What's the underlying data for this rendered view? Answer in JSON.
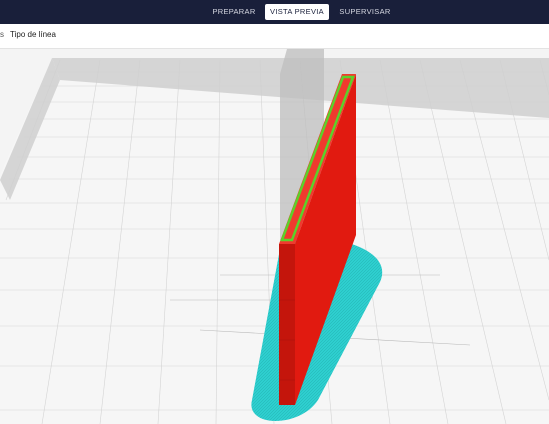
{
  "header": {
    "tabs": [
      {
        "label": "PREPARAR",
        "active": false
      },
      {
        "label": "VISTA PREVIA",
        "active": true
      },
      {
        "label": "SUPERVISAR",
        "active": false
      }
    ]
  },
  "toolbar": {
    "lead_glyph": "s",
    "view_type_label": "Tipo de línea"
  },
  "colors": {
    "topbar": "#191f3a",
    "wall_outer": "#e11a10",
    "wall_inner": "#5cd12a",
    "skirt": "#2ecfcf",
    "plate": "#f6f6f6",
    "plate_border": "#c9c9c9"
  }
}
